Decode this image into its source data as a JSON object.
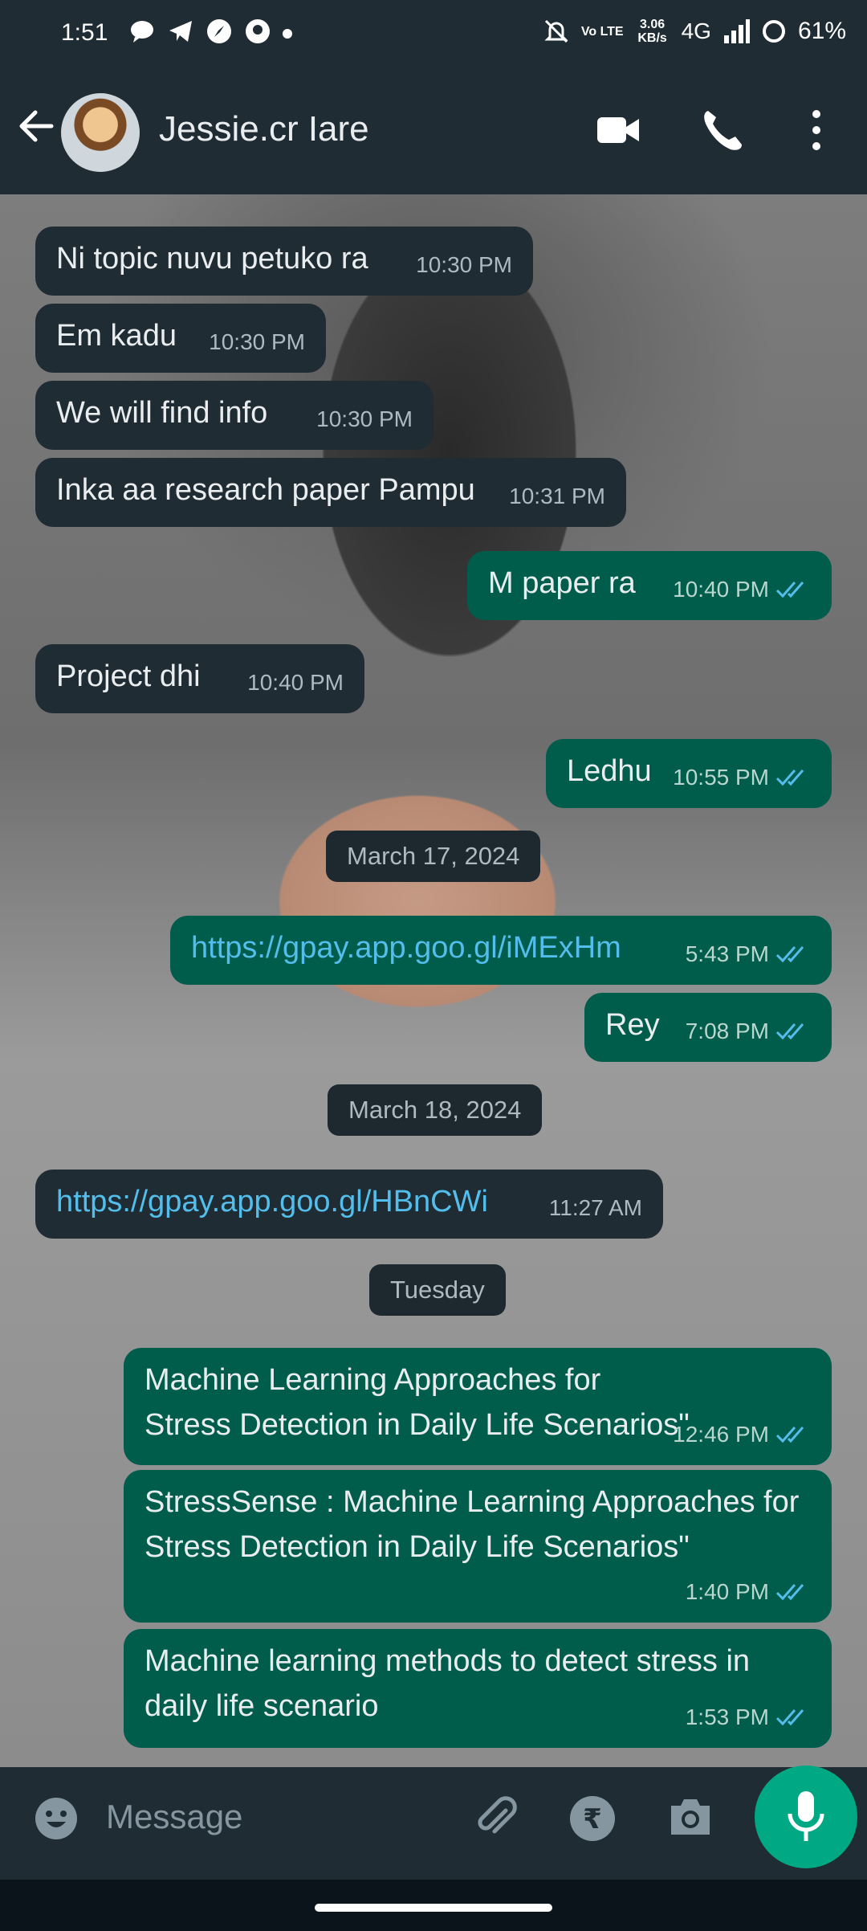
{
  "status_bar": {
    "time": "1:51",
    "data_speed": "3.06 KB/s",
    "volte": "Vo LTE",
    "network": "4G",
    "battery": "61%"
  },
  "header": {
    "contact_name": "Jessie.cr Iare"
  },
  "messages": [
    {
      "dir": "in",
      "text": "Ni topic nuvu petuko ra",
      "time": "10:30 PM"
    },
    {
      "dir": "in",
      "text": "Em kadu",
      "time": "10:30 PM"
    },
    {
      "dir": "in",
      "text": "We will find info",
      "time": "10:30 PM"
    },
    {
      "dir": "in",
      "text": "Inka aa research paper Pampu",
      "time": "10:31 PM"
    },
    {
      "dir": "out",
      "text": "M paper ra",
      "time": "10:40 PM"
    },
    {
      "dir": "in",
      "text": "Project dhi",
      "time": "10:40 PM"
    },
    {
      "dir": "out",
      "text": "Ledhu",
      "time": "10:55 PM"
    },
    {
      "dir": "out",
      "text": "https://gpay.app.goo.gl/iMExHm",
      "time": "5:43 PM"
    },
    {
      "dir": "out",
      "text": "Rey",
      "time": "7:08 PM"
    },
    {
      "dir": "in",
      "text": "https://gpay.app.goo.gl/HBnCWi",
      "time": "11:27 AM"
    },
    {
      "dir": "out",
      "text": "Machine Learning Approaches for Stress Detection in Daily Life Scenarios\"",
      "time": "12:46 PM"
    },
    {
      "dir": "out",
      "text": "StressSense : Machine Learning Approaches for Stress Detection in Daily Life Scenarios\"",
      "time": "1:40 PM"
    },
    {
      "dir": "out",
      "text": "Machine learning methods to detect stress in daily life scenario",
      "time": "1:53 PM"
    }
  ],
  "date_separators": [
    "March 17, 2024",
    "March 18, 2024",
    "Tuesday"
  ],
  "composer": {
    "placeholder": "Message"
  },
  "colors": {
    "incoming_bubble": "#202c33",
    "outgoing_bubble": "#005c4b",
    "link": "#53bdeb",
    "read_ticks": "#53bdeb",
    "mic_button": "#00a884"
  }
}
